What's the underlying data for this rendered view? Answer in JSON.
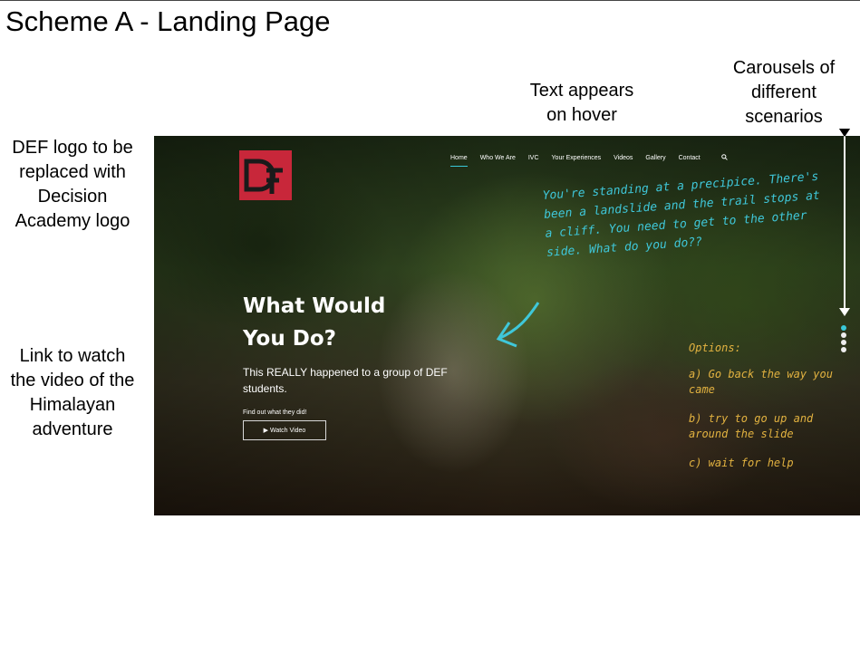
{
  "slide": {
    "title": "Scheme A - Landing Page"
  },
  "annotations": {
    "logo_note": [
      "DEF logo to be",
      "replaced with",
      "Decision",
      "Academy logo"
    ],
    "video_note": [
      "Link to watch",
      "the video of the",
      "Himalayan",
      "adventure"
    ],
    "hover_note": [
      "Text appears",
      "on hover"
    ],
    "carousel_note": [
      "Carousels of",
      "different",
      "scenarios"
    ]
  },
  "site": {
    "logo": {
      "text": "DEF",
      "color": "#c8273a"
    },
    "nav": [
      "Home",
      "Who We Are",
      "IVC",
      "Your Experiences",
      "Videos",
      "Gallery",
      "Contact"
    ],
    "nav_active": "Home",
    "search_icon": "search-icon",
    "heading": [
      "What Would",
      "You Do?"
    ],
    "subtext": "This REALLY happened to a group of DEF students.",
    "find_out": "Find out what they did!",
    "watch_button": "▶ Watch Video",
    "hover_text": "You're standing at a precipice. There's been a landslide and the trail stops at a cliff. You need to get to the other side. What do you do??",
    "options_title": "Options:",
    "options": [
      "a) Go back the way you came",
      "b) try to go up and around the slide",
      "c) wait for help"
    ],
    "carousel": {
      "count": 4,
      "active_index": 0
    },
    "accent_color": "#39c8d8",
    "options_color": "#e2b240"
  }
}
